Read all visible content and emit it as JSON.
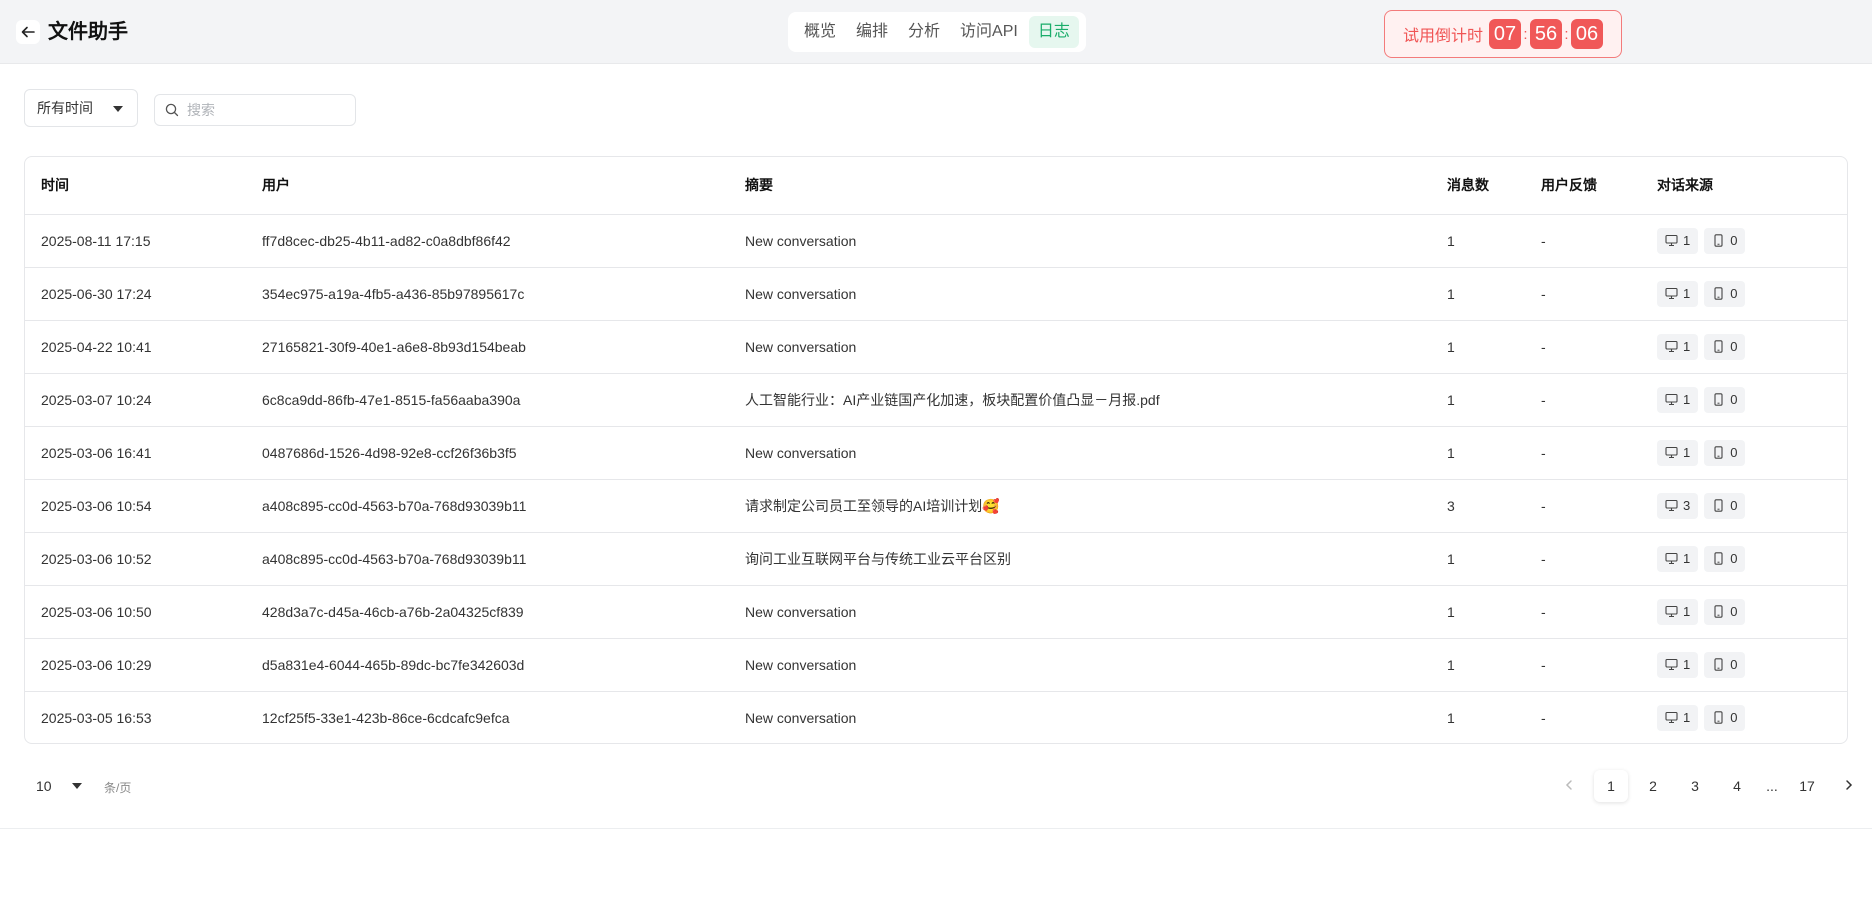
{
  "header": {
    "title": "文件助手",
    "tabs": [
      {
        "label": "概览",
        "active": false
      },
      {
        "label": "编排",
        "active": false
      },
      {
        "label": "分析",
        "active": false
      },
      {
        "label": "访问API",
        "active": false
      },
      {
        "label": "日志",
        "active": true
      }
    ],
    "trial": {
      "label": "试用倒计时",
      "hours": "07",
      "minutes": "56",
      "seconds": "06",
      "sep": ":"
    }
  },
  "filters": {
    "time_range": "所有时间",
    "search_placeholder": "搜索"
  },
  "table": {
    "columns": [
      "时间",
      "用户",
      "摘要",
      "消息数",
      "用户反馈",
      "对话来源"
    ],
    "rows": [
      {
        "time": "2025-08-11 17:15",
        "user": "ff7d8cec-db25-4b11-ad82-c0a8dbf86f42",
        "summary": "New conversation",
        "messages": "1",
        "feedback": "-",
        "desktop": "1",
        "mobile": "0"
      },
      {
        "time": "2025-06-30 17:24",
        "user": "354ec975-a19a-4fb5-a436-85b97895617c",
        "summary": "New conversation",
        "messages": "1",
        "feedback": "-",
        "desktop": "1",
        "mobile": "0"
      },
      {
        "time": "2025-04-22 10:41",
        "user": "27165821-30f9-40e1-a6e8-8b93d154beab",
        "summary": "New conversation",
        "messages": "1",
        "feedback": "-",
        "desktop": "1",
        "mobile": "0"
      },
      {
        "time": "2025-03-07 10:24",
        "user": "6c8ca9dd-86fb-47e1-8515-fa56aaba390a",
        "summary": "人工智能行业：AI产业链国产化加速，板块配置价值凸显－月报.pdf",
        "messages": "1",
        "feedback": "-",
        "desktop": "1",
        "mobile": "0"
      },
      {
        "time": "2025-03-06 16:41",
        "user": "0487686d-1526-4d98-92e8-ccf26f36b3f5",
        "summary": "New conversation",
        "messages": "1",
        "feedback": "-",
        "desktop": "1",
        "mobile": "0"
      },
      {
        "time": "2025-03-06 10:54",
        "user": "a408c895-cc0d-4563-b70a-768d93039b11",
        "summary": "请求制定公司员工至领导的AI培训计划🥰",
        "messages": "3",
        "feedback": "-",
        "desktop": "3",
        "mobile": "0"
      },
      {
        "time": "2025-03-06 10:52",
        "user": "a408c895-cc0d-4563-b70a-768d93039b11",
        "summary": "询问工业互联网平台与传统工业云平台区别",
        "messages": "1",
        "feedback": "-",
        "desktop": "1",
        "mobile": "0"
      },
      {
        "time": "2025-03-06 10:50",
        "user": "428d3a7c-d45a-46cb-a76b-2a04325cf839",
        "summary": "New conversation",
        "messages": "1",
        "feedback": "-",
        "desktop": "1",
        "mobile": "0"
      },
      {
        "time": "2025-03-06 10:29",
        "user": "d5a831e4-6044-465b-89dc-bc7fe342603d",
        "summary": "New conversation",
        "messages": "1",
        "feedback": "-",
        "desktop": "1",
        "mobile": "0"
      },
      {
        "time": "2025-03-05 16:53",
        "user": "12cf25f5-33e1-423b-86ce-6cdcafc9efca",
        "summary": "New conversation",
        "messages": "1",
        "feedback": "-",
        "desktop": "1",
        "mobile": "0"
      }
    ]
  },
  "pagination": {
    "page_size": "10",
    "per_page_label": "条/页",
    "pages": [
      "1",
      "2",
      "3",
      "4",
      "...",
      "17"
    ],
    "current": "1"
  },
  "icons": {
    "back": "arrow-left-icon",
    "search": "search-icon",
    "desktop": "monitor-icon",
    "mobile": "phone-icon",
    "prev": "chevron-left-icon",
    "next": "chevron-right-icon"
  },
  "colors": {
    "accent": "#1aad6a",
    "trial": "#f05858"
  }
}
